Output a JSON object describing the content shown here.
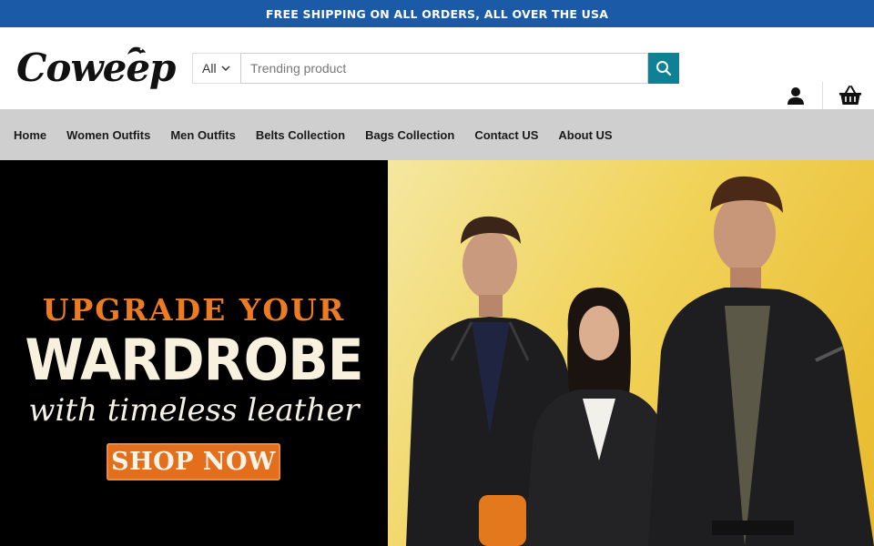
{
  "topbar": {
    "text": "FREE SHIPPING ON ALL ORDERS, ALL OVER THE USA"
  },
  "brand": {
    "logo_text": "Coweep"
  },
  "search": {
    "category": "All",
    "placeholder": "Trending product",
    "value": ""
  },
  "nav": {
    "items": [
      {
        "label": "Home"
      },
      {
        "label": "Women Outfits"
      },
      {
        "label": "Men Outfits"
      },
      {
        "label": "Belts Collection"
      },
      {
        "label": "Bags Collection"
      },
      {
        "label": "Contact US"
      },
      {
        "label": "About US"
      }
    ]
  },
  "hero": {
    "line1": "UPGRADE YOUR",
    "line2": "WARDROBE",
    "line3": "with timeless leather",
    "cta": "SHOP NOW"
  },
  "icons": {
    "search": "search-icon",
    "account": "user-icon",
    "cart": "basket-icon",
    "category": "chevron-down-icon"
  },
  "colors": {
    "topbar": "#1b5aa6",
    "search_button": "#0f8194",
    "nav_bg": "#cfcfcf",
    "accent_orange": "#e36f1c",
    "hero_left_bg": "#000000",
    "hero_right_bg": "#f1d35a"
  }
}
